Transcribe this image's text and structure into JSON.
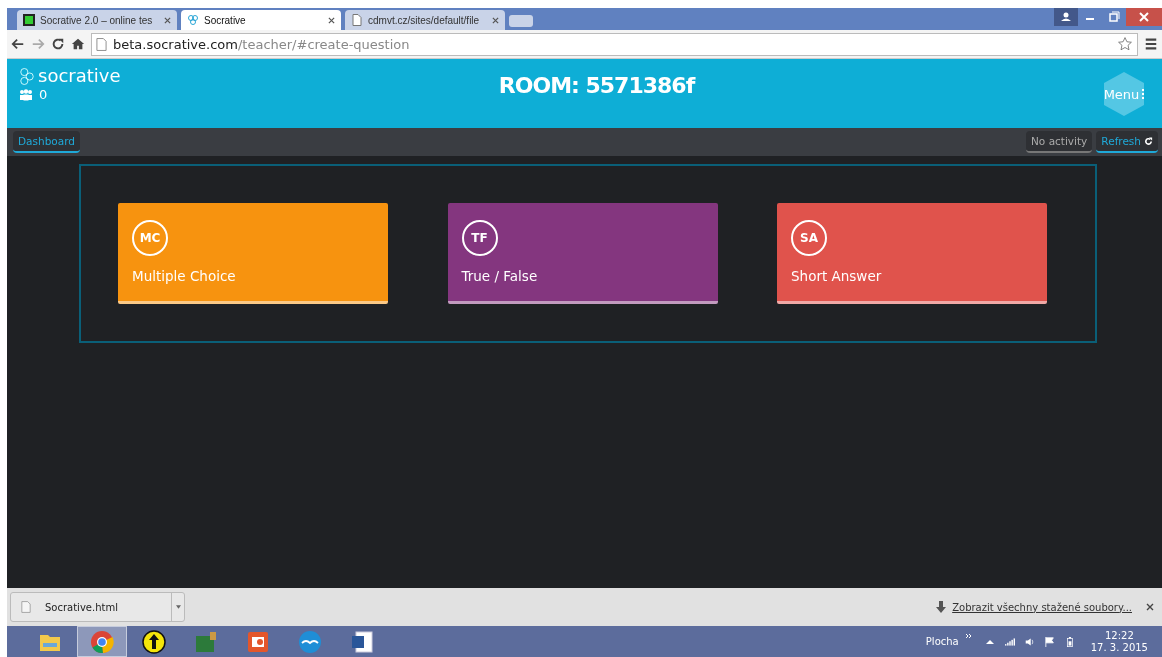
{
  "browser_tabs": [
    {
      "title": "Socrative 2.0 – online tes",
      "selected": false,
      "kind": "app"
    },
    {
      "title": "Socrative",
      "selected": true,
      "kind": "logo"
    },
    {
      "title": "cdmvt.cz/sites/default/file",
      "selected": false,
      "kind": "doc"
    }
  ],
  "address_bar": {
    "host": "beta.socrative.com",
    "path": "/teacher/#create-question"
  },
  "header": {
    "brand": "socrative",
    "student_count": "0",
    "room": "ROOM: 5571386f",
    "menu": "Menu"
  },
  "subbar": {
    "dashboard": "Dashboard",
    "status": "No activity",
    "refresh": "Refresh"
  },
  "question_types": [
    {
      "abbr": "MC",
      "label": "Multiple Choice",
      "color": "#f7930f"
    },
    {
      "abbr": "TF",
      "label": "True / False",
      "color": "#84367f"
    },
    {
      "abbr": "SA",
      "label": "Short Answer",
      "color": "#e0534c"
    }
  ],
  "download_bar": {
    "file": "Socrative.html",
    "show_all": "Zobrazit všechny stažené soubory..."
  },
  "taskbar": {
    "apps": [
      {
        "kind": "folder",
        "selected": false
      },
      {
        "kind": "chrome",
        "selected": true
      },
      {
        "kind": "arrow",
        "selected": false
      },
      {
        "kind": "cps",
        "selected": false
      },
      {
        "kind": "impress",
        "selected": false
      },
      {
        "kind": "office",
        "selected": false
      },
      {
        "kind": "word",
        "selected": false
      }
    ],
    "desktop": "Plocha",
    "time": "12:22",
    "date": "17. 3. 2015"
  }
}
